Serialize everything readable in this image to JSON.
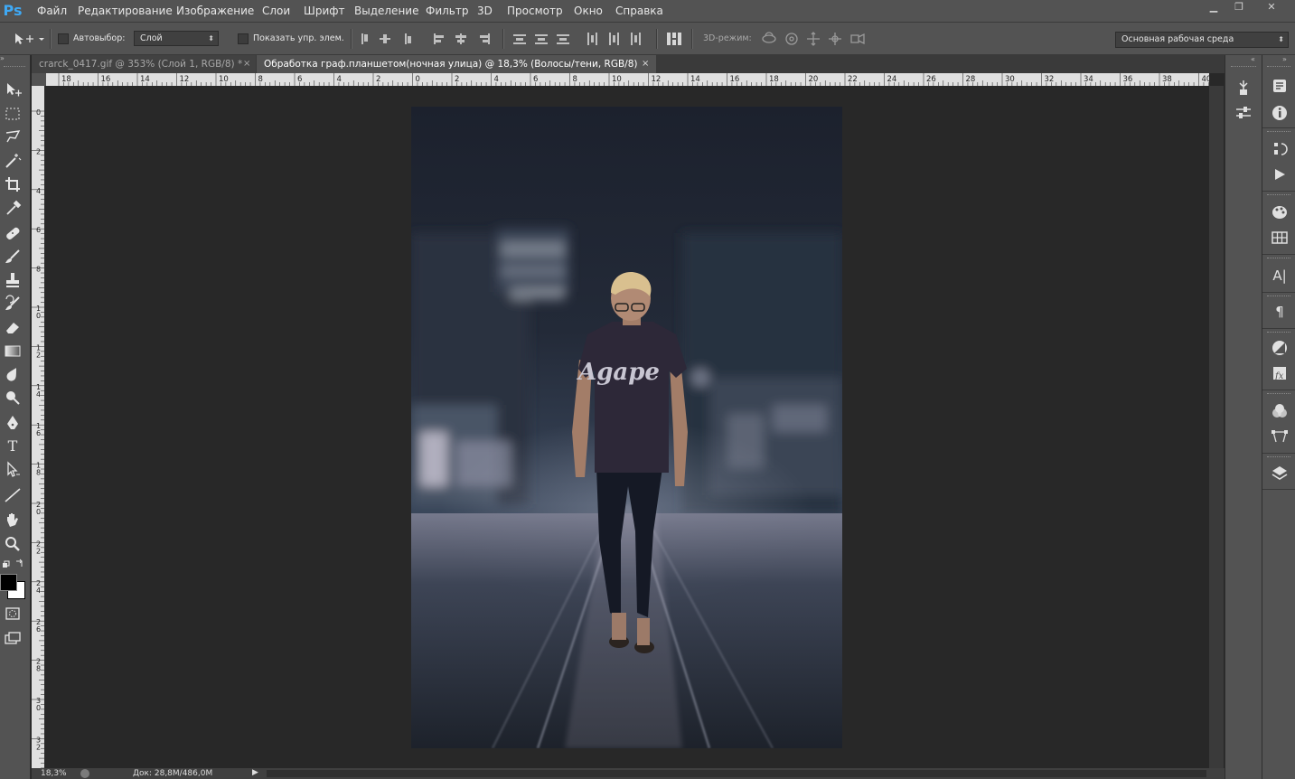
{
  "app": {
    "logo": "Ps"
  },
  "menubar": {
    "items": [
      "Файл",
      "Редактирование",
      "Изображение",
      "Слои",
      "Шрифт",
      "Выделение",
      "Фильтр",
      "3D",
      "Просмотр",
      "Окно",
      "Справка"
    ]
  },
  "window_controls": {
    "minimize": "▁",
    "restore": "❐",
    "close": "✕"
  },
  "options": {
    "autoselect_label": "Автовыбор:",
    "autoselect_value": "Слой",
    "show_transform_label": "Показать упр. элем.",
    "mode_3d_label": "3D-режим:",
    "workspace_value": "Основная рабочая среда"
  },
  "tabs": [
    {
      "title": "crarck_0417.gif @ 353% (Слой 1, RGB/8) *",
      "close": "×",
      "active": false
    },
    {
      "title": "Обработка граф.планшетом(ночная улица) @ 18,3% (Волосы/тени, RGB/8)",
      "close": "×",
      "active": true
    }
  ],
  "ruler_top": [
    "18",
    "16",
    "14",
    "12",
    "10",
    "8",
    "6",
    "4",
    "2",
    "0",
    "2",
    "4",
    "6",
    "8",
    "10",
    "12",
    "14",
    "16",
    "18",
    "20",
    "22",
    "24",
    "26",
    "28",
    "30",
    "32",
    "34",
    "36",
    "38",
    "40"
  ],
  "ruler_left": [
    "0",
    "2",
    "4",
    "6",
    "8",
    "10",
    "12",
    "14",
    "16",
    "18",
    "20",
    "22",
    "24",
    "26",
    "28",
    "30",
    "32"
  ],
  "status": {
    "zoom": "18,3%",
    "doc": "Док: 28,8M/486,0M"
  },
  "image": {
    "tshirt_text": "Agape"
  },
  "colors": {
    "ui_bg": "#535353",
    "canvas_bg": "#282828",
    "accent": "#3fa9f5"
  },
  "tools": [
    "move-tool",
    "marquee-tool",
    "lasso-tool",
    "magic-wand-tool",
    "crop-tool",
    "eyedropper-tool",
    "healing-brush-tool",
    "brush-tool",
    "clone-stamp-tool",
    "history-brush-tool",
    "eraser-tool",
    "gradient-tool",
    "blur-tool",
    "dodge-tool",
    "pen-tool",
    "type-tool",
    "path-selection-tool",
    "line-tool",
    "hand-tool",
    "zoom-tool"
  ]
}
